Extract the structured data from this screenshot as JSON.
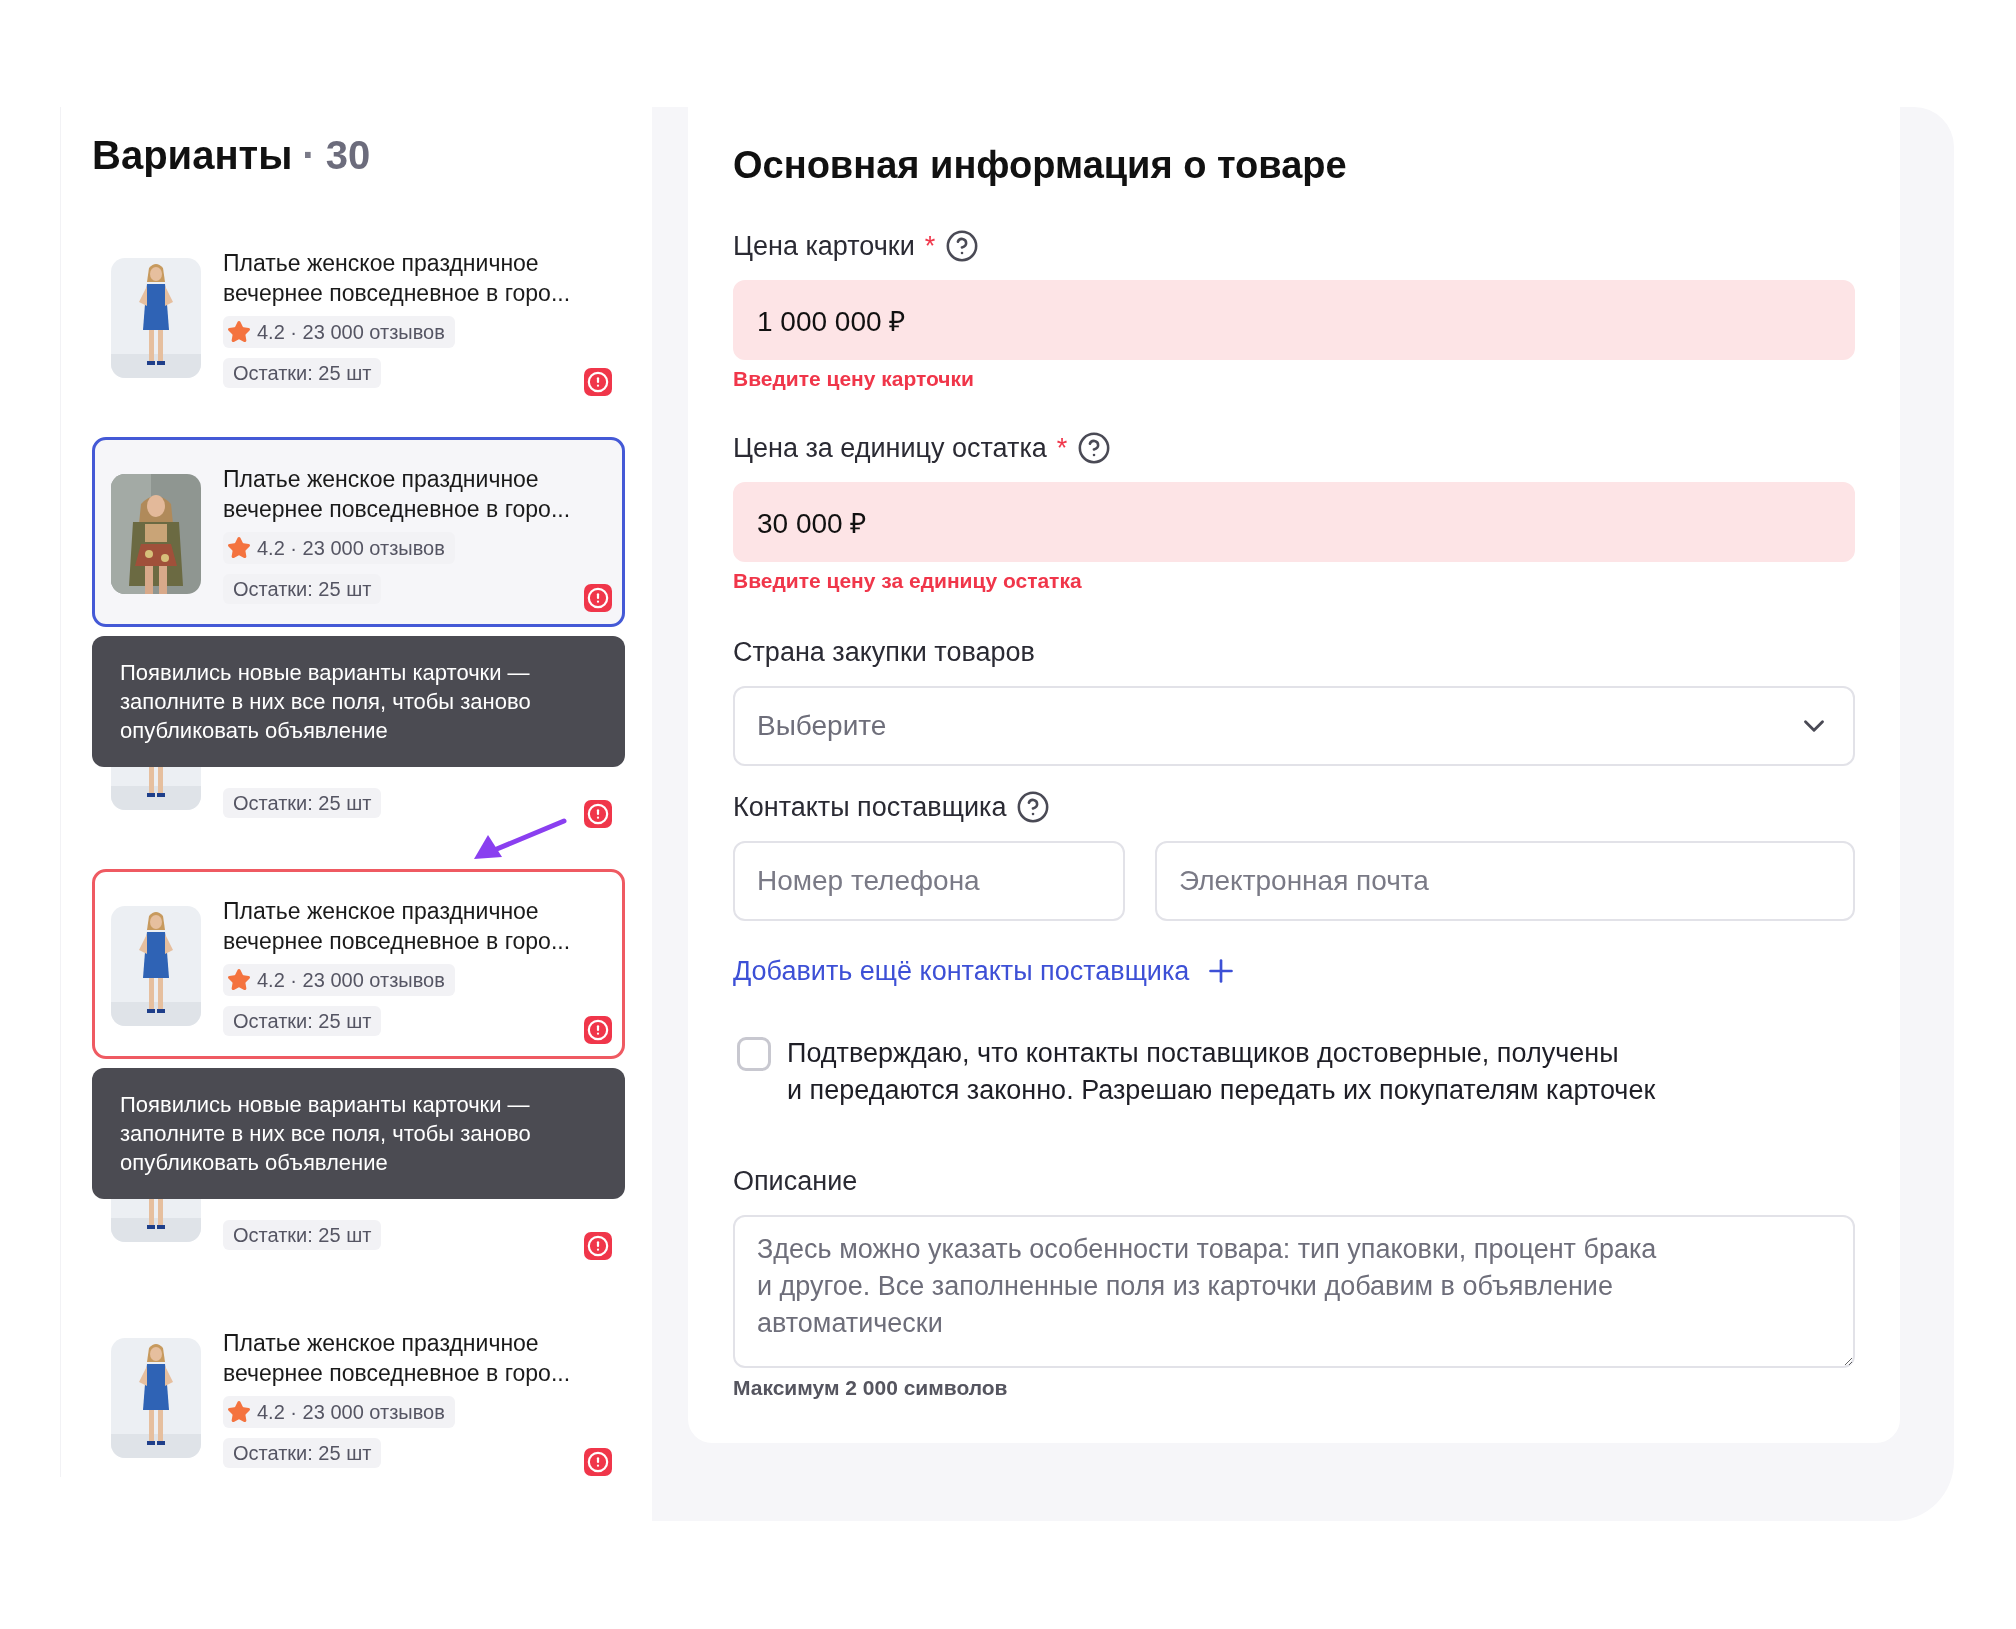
{
  "variants": {
    "title": "Варианты",
    "separator": "·",
    "count": "30",
    "items": [
      {
        "kind": "full",
        "title": "Платье женское праздничное вечернее повседневное в горо...",
        "rating": "4.2 · 23 000 отзывов",
        "stock": "Остатки: 25 шт",
        "selected": false,
        "invalid": false
      },
      {
        "kind": "full",
        "title": "Платье женское праздничное вечернее повседневное в горо...",
        "rating": "4.2 · 23 000 отзывов",
        "stock": "Остатки: 25 шт",
        "selected": true,
        "invalid": false
      },
      {
        "kind": "covered",
        "stock": "Остатки: 25 шт",
        "selected": false,
        "invalid": false,
        "tooltip": "Появились новые варианты карточки — заполните в них все поля, чтобы заново опубликовать объявление"
      },
      {
        "kind": "full",
        "title": "Платье женское праздничное вечернее повседневное в горо...",
        "rating": "4.2 · 23 000 отзывов",
        "stock": "Остатки: 25 шт",
        "selected": false,
        "invalid": true
      },
      {
        "kind": "covered",
        "stock": "Остатки: 25 шт",
        "selected": false,
        "invalid": false,
        "tooltip": "Появились новые варианты карточки — заполните в них все поля, чтобы заново опубликовать объявление"
      },
      {
        "kind": "full",
        "title": "Платье женское праздничное вечернее повседневное в горо...",
        "rating": "4.2 · 23 000 отзывов",
        "stock": "Остатки: 25 шт",
        "selected": false,
        "invalid": false
      }
    ]
  },
  "form": {
    "title": "Основная информация о товаре",
    "fields": [
      {
        "kind": "input",
        "label": "Цена карточки",
        "required_mark": "*",
        "help": true,
        "value": "1 000 000 ₽",
        "error": "Введите цену карточки"
      },
      {
        "kind": "input",
        "label": "Цена за единицу остатка",
        "required_mark": "*",
        "help": true,
        "value": "30 000 ₽",
        "error": "Введите цену за единицу остатка"
      },
      {
        "kind": "select",
        "label": "Страна закупки товаров",
        "placeholder": "Выберите"
      },
      {
        "kind": "contacts",
        "label": "Контакты поставщика",
        "help": true,
        "phone_placeholder": "Номер телефона",
        "email_placeholder": "Электронная почта",
        "add_link": "Добавить ещё контакты поставщика"
      },
      {
        "kind": "checkbox",
        "checked": false,
        "text": "Подтверждаю, что контакты поставщиков достоверные, получены\nи передаются законно. Разрешаю передать их покупателям карточек"
      },
      {
        "kind": "textarea",
        "label": "Описание",
        "placeholder": "Здесь можно указать особенности товара: тип упаковки, процент брака\nи другое. Все заполненные поля из карточки добавим в объявление\nавтоматически",
        "hint": "Максимум 2 000 символов"
      }
    ]
  }
}
